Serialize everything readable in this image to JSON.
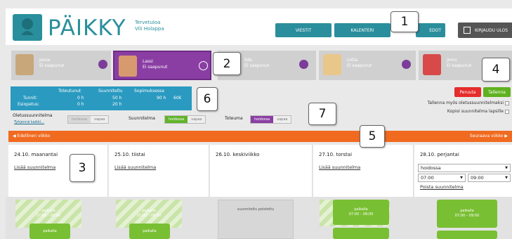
{
  "header": {
    "brand": "PÄIKKY",
    "welcome_line1": "Tervetuloa",
    "welcome_line2": "Vili Holappa",
    "nav": [
      "VIESTIT",
      "KALENTERI",
      "EDOT"
    ],
    "logout": "KIRJAUDU ULOS"
  },
  "children": [
    {
      "name": "Jesse",
      "status": "Ei saapunut"
    },
    {
      "name": "Lassi",
      "status": "Ei saapunut"
    },
    {
      "name": "Iida",
      "status": "Ei saapunut"
    },
    {
      "name": "Lotta",
      "status": "Ei saapunut"
    },
    {
      "name": "Jenni",
      "status": "Ei saapunut"
    }
  ],
  "hours": {
    "col_headers": [
      "Toteutunut",
      "Suunniteltu",
      "Sopimuksessa"
    ],
    "rows": [
      {
        "label": "Tunnit:",
        "values": [
          "0 h",
          "50 h",
          "90 h"
        ],
        "extra": "60€"
      },
      {
        "label": "Esiopetus:",
        "values": [
          "0 h",
          "20 h",
          ""
        ]
      }
    ]
  },
  "actions": {
    "cancel": "Peruuta",
    "save": "Tallenna",
    "save_default": "Tallenna myös oletussuunnitelmaksi",
    "copy_plan": "Kopioi suunnitelma lapsille"
  },
  "plan_toggles": {
    "default_label": "Oletussuunnitelma",
    "clear_all": "Tyhjennä kaikki...",
    "plan_label": "Suunnitelma",
    "actual_label": "Toteuma",
    "opt_present": "hoidossa",
    "opt_free": "vapaa"
  },
  "week_nav": {
    "prev": "◀ Edellinen viikko",
    "next": "Seuraava viikko ▶"
  },
  "days": [
    {
      "date": "24.10. maanantai",
      "add": "Lisää suunnitelma"
    },
    {
      "date": "25.10. tiistai",
      "add": "Lisää suunnitelma"
    },
    {
      "date": "26.10. keskiviikko",
      "add": ""
    },
    {
      "date": "27.10. torstai",
      "add": "Lisää suunnitelma"
    },
    {
      "date": "28.10. perjantai",
      "add": ""
    }
  ],
  "friday": {
    "type_value": "hoidossa",
    "from": "07:00",
    "to": "09:00",
    "remove": "Poista suunnitelma"
  },
  "slots": {
    "present": "paikalla",
    "time": "07:00 – 09:00",
    "deleted": "suunniteltu poistettu"
  },
  "callouts": [
    "1",
    "2",
    "3",
    "4",
    "5",
    "6",
    "7"
  ],
  "colors": {
    "teal": "#2b8e9c",
    "purple": "#8a3ea3",
    "orange": "#f06a1f",
    "green": "#5fb21f",
    "red": "#e62c2c",
    "blue": "#2a9ac0"
  }
}
